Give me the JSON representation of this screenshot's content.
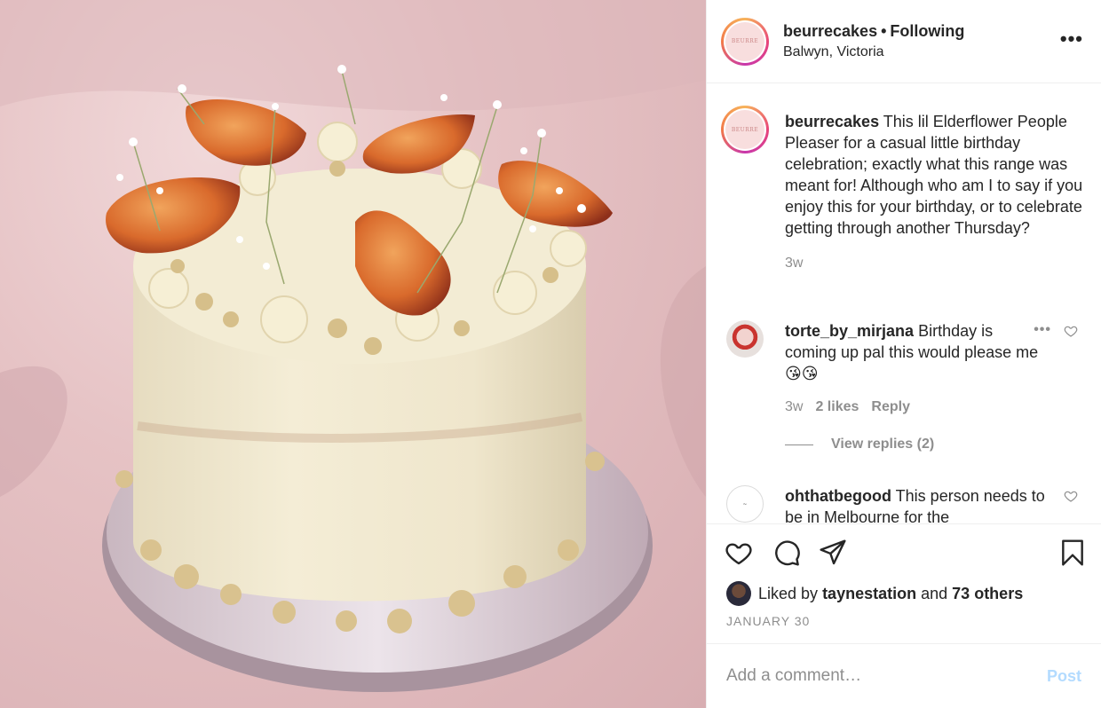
{
  "post": {
    "image_alt": "Elderflower cake with peaches",
    "author": {
      "username": "beurrecakes",
      "follow_state": "Following",
      "location": "Balwyn, Victoria",
      "avatar_text": "BEURRE"
    },
    "caption": {
      "username": "beurrecakes",
      "text": "This lil Elderflower People Pleaser for a casual little birthday celebration; exactly what this range was meant for! Although who am I to say if you enjoy this for your birthday, or to celebrate getting through another Thursday?",
      "age": "3w"
    },
    "comments": [
      {
        "username": "torte_by_mirjana",
        "text": "Birthday is coming up pal this would please me 😘😘",
        "age": "3w",
        "likes": "2 likes",
        "reply_label": "Reply",
        "view_replies": "View replies (2)"
      },
      {
        "username": "ohthatbegood",
        "text": "This person needs to be in Melbourne for the"
      }
    ],
    "likes": {
      "prefix": "Liked by",
      "user": "taynestation",
      "joiner": "and",
      "others": "73 others"
    },
    "date": "JANUARY 30"
  },
  "comment_box": {
    "placeholder": "Add a comment…",
    "post_label": "Post"
  },
  "icons": {
    "more": "more-horizontal-icon",
    "like": "heart-icon",
    "comment": "speech-bubble-icon",
    "share": "paper-plane-icon",
    "save": "bookmark-icon"
  },
  "colors": {
    "text": "#262626",
    "muted": "#8e8e8e",
    "post_disabled": "#b3dbff",
    "border": "#efefef"
  }
}
